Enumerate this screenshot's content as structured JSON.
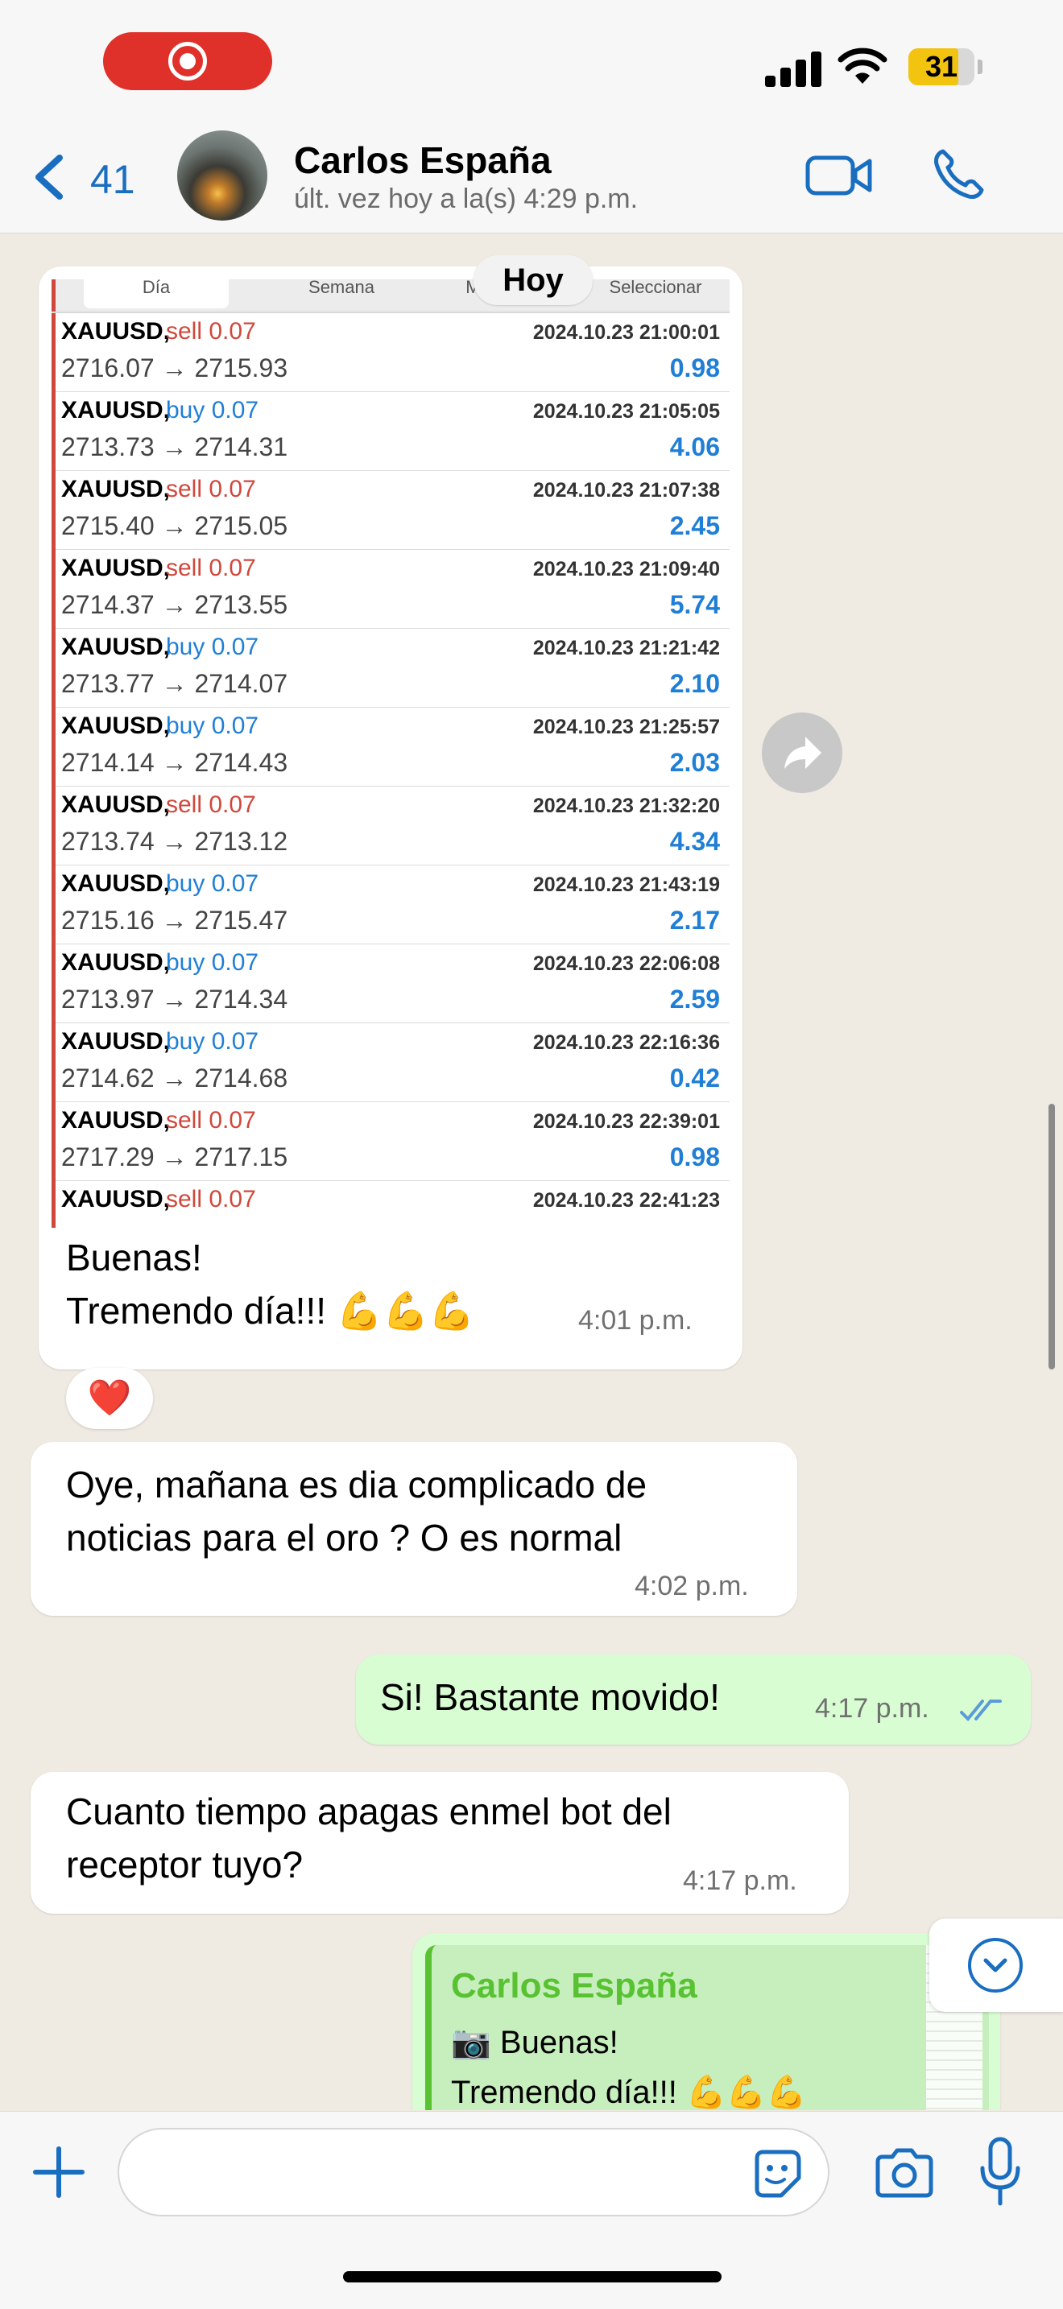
{
  "status_bar": {
    "battery": "31"
  },
  "header": {
    "back_count": "41",
    "contact_name": "Carlos España",
    "last_seen": "últ. vez hoy a la(s) 4:29 p.m."
  },
  "date_chip": "Hoy",
  "screenshot": {
    "tabs": [
      "Día",
      "Semana",
      "Mes",
      "Seleccionar"
    ],
    "trades": [
      {
        "symbol": "XAUUSD,",
        "side": "sell",
        "volume": "0.07",
        "datetime": "2024.10.23 21:00:01",
        "prices": "2716.07 → 2715.93",
        "profit": "0.98"
      },
      {
        "symbol": "XAUUSD,",
        "side": "buy",
        "volume": "0.07",
        "datetime": "2024.10.23 21:05:05",
        "prices": "2713.73 → 2714.31",
        "profit": "4.06"
      },
      {
        "symbol": "XAUUSD,",
        "side": "sell",
        "volume": "0.07",
        "datetime": "2024.10.23 21:07:38",
        "prices": "2715.40 → 2715.05",
        "profit": "2.45"
      },
      {
        "symbol": "XAUUSD,",
        "side": "sell",
        "volume": "0.07",
        "datetime": "2024.10.23 21:09:40",
        "prices": "2714.37 → 2713.55",
        "profit": "5.74"
      },
      {
        "symbol": "XAUUSD,",
        "side": "buy",
        "volume": "0.07",
        "datetime": "2024.10.23 21:21:42",
        "prices": "2713.77 → 2714.07",
        "profit": "2.10"
      },
      {
        "symbol": "XAUUSD,",
        "side": "buy",
        "volume": "0.07",
        "datetime": "2024.10.23 21:25:57",
        "prices": "2714.14 → 2714.43",
        "profit": "2.03"
      },
      {
        "symbol": "XAUUSD,",
        "side": "sell",
        "volume": "0.07",
        "datetime": "2024.10.23 21:32:20",
        "prices": "2713.74 → 2713.12",
        "profit": "4.34"
      },
      {
        "symbol": "XAUUSD,",
        "side": "buy",
        "volume": "0.07",
        "datetime": "2024.10.23 21:43:19",
        "prices": "2715.16 → 2715.47",
        "profit": "2.17"
      },
      {
        "symbol": "XAUUSD,",
        "side": "buy",
        "volume": "0.07",
        "datetime": "2024.10.23 22:06:08",
        "prices": "2713.97 → 2714.34",
        "profit": "2.59"
      },
      {
        "symbol": "XAUUSD,",
        "side": "buy",
        "volume": "0.07",
        "datetime": "2024.10.23 22:16:36",
        "prices": "2714.62 → 2714.68",
        "profit": "0.42"
      },
      {
        "symbol": "XAUUSD,",
        "side": "sell",
        "volume": "0.07",
        "datetime": "2024.10.23 22:39:01",
        "prices": "2717.29 → 2717.15",
        "profit": "0.98"
      },
      {
        "symbol": "XAUUSD,",
        "side": "sell",
        "volume": "0.07",
        "datetime": "2024.10.23 22:41:23",
        "prices": "",
        "profit": ""
      }
    ]
  },
  "messages": [
    {
      "id": "m1",
      "direction": "in",
      "text_line1": "Buenas!",
      "text_line2": "Tremendo día!!! 💪💪💪",
      "time": "4:01 p.m.",
      "reaction": "❤️"
    },
    {
      "id": "m2",
      "direction": "in",
      "text_line1": "Oye, mañana es dia complicado de",
      "text_line2": "noticias para el oro ? O es normal",
      "time": "4:02 p.m."
    },
    {
      "id": "m3",
      "direction": "out",
      "text_line1": "Si! Bastante movido!",
      "time": "4:17 p.m.",
      "status": "read"
    },
    {
      "id": "m4",
      "direction": "in",
      "text_line1": "Cuanto tiempo apagas enmel bot del",
      "text_line2": "receptor tuyo?",
      "time": "4:17 p.m."
    }
  ],
  "reply_preview": {
    "author": "Carlos España",
    "line1": "Buenas!",
    "line2": "Tremendo día!!! 💪💪💪"
  },
  "colors": {
    "sell": "#d0483c",
    "buy": "#1f7fd6",
    "outgoing_bubble": "#d9fdd3",
    "accent": "#1a6ec0"
  }
}
